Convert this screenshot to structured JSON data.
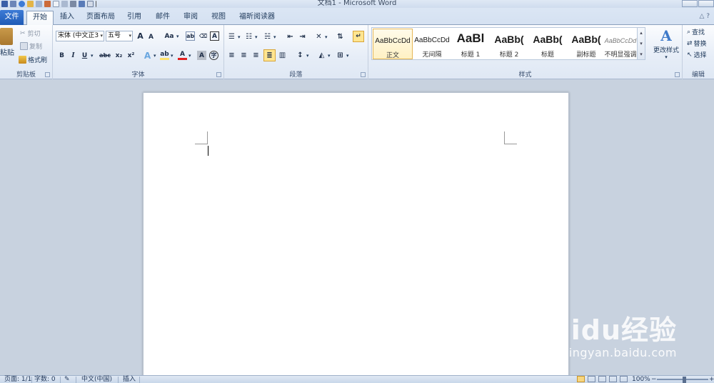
{
  "window": {
    "title": "文档1 - Microsoft Word"
  },
  "tabs": [
    {
      "label": "文件"
    },
    {
      "label": "开始"
    },
    {
      "label": "插入"
    },
    {
      "label": "页面布局"
    },
    {
      "label": "引用"
    },
    {
      "label": "邮件"
    },
    {
      "label": "审阅"
    },
    {
      "label": "视图"
    },
    {
      "label": "福昕阅读器"
    }
  ],
  "clipboard": {
    "label": "剪贴板",
    "paste": "粘贴",
    "cut": "剪切",
    "copy": "复制",
    "format_painter": "格式刷"
  },
  "font": {
    "label": "字体",
    "font_name": "宋体 (中文正3",
    "font_size": "五号",
    "grow": "A",
    "shrink": "A",
    "change_case": "Aa",
    "bold": "B",
    "italic": "I",
    "underline": "U",
    "strike": "abc",
    "subscript": "x₂",
    "superscript": "x²"
  },
  "paragraph": {
    "label": "段落"
  },
  "styles": {
    "label": "样式",
    "items": [
      {
        "sample": "AaBbCcDd",
        "name": "正文"
      },
      {
        "sample": "AaBbCcDd",
        "name": "无间隔"
      },
      {
        "sample": "AaBl",
        "name": "标题 1"
      },
      {
        "sample": "AaBb(",
        "name": "标题 2"
      },
      {
        "sample": "AaBb(",
        "name": "标题"
      },
      {
        "sample": "AaBb(",
        "name": "副标题"
      },
      {
        "sample": "AaBbCcDd",
        "name": "不明显强调"
      }
    ],
    "change_styles": "更改样式"
  },
  "editing": {
    "label": "编辑",
    "find": "查找",
    "replace": "替换",
    "select": "选择"
  },
  "statusbar": {
    "page": "页面: 1/1",
    "words": "字数: 0",
    "language": "中文(中国)",
    "insert": "插入",
    "zoom": "100%"
  },
  "watermark": {
    "brand": "Baidu经验",
    "url": "jingyan.baidu.com"
  },
  "colors": {
    "file_tab": "#2a66c4",
    "highlight": "#ffe26b",
    "font_color": "#e02020"
  }
}
